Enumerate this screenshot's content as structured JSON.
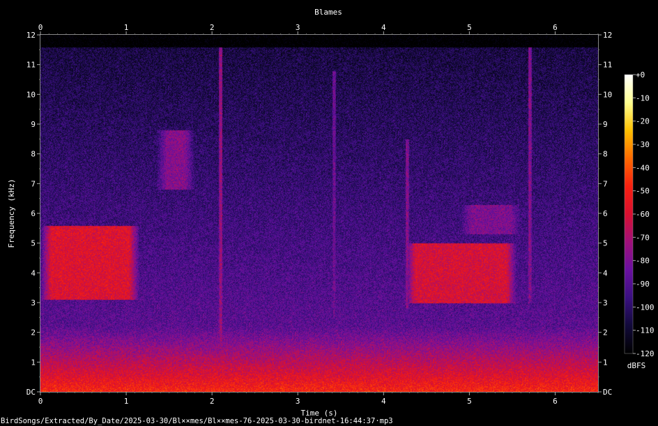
{
  "chart_data": {
    "type": "heatmap",
    "title": "Blames",
    "xlabel": "Time (s)",
    "ylabel": "Frequency (kHz)",
    "xlim": [
      0,
      6.5
    ],
    "ylim": [
      0,
      12
    ],
    "x_ticks": [
      "0",
      "1",
      "2",
      "3",
      "4",
      "5",
      "6"
    ],
    "y_ticks": [
      "DC",
      "1",
      "2",
      "3",
      "4",
      "5",
      "6",
      "7",
      "8",
      "9",
      "10",
      "11",
      "12"
    ],
    "colorbar": {
      "label": "dBFS",
      "range": [
        -120,
        0
      ],
      "ticks": [
        "+0",
        "-10",
        "-20",
        "-30",
        "-40",
        "-50",
        "-60",
        "-70",
        "-80",
        "-90",
        "-100",
        "-110",
        "-120"
      ],
      "colors": [
        "#000000",
        "#120a3a",
        "#3a1080",
        "#6a10a0",
        "#a0107a",
        "#d81030",
        "#f82010",
        "#ff6a00",
        "#ffc000",
        "#ffff90",
        "#ffffff"
      ]
    },
    "grid": false,
    "features": [
      {
        "kind": "band",
        "t": [
          0.0,
          1.15
        ],
        "f": [
          3.1,
          5.6
        ],
        "level": -58
      },
      {
        "kind": "band",
        "t": [
          4.25,
          5.55
        ],
        "f": [
          3.0,
          5.0
        ],
        "level": -60
      },
      {
        "kind": "band",
        "t": [
          1.35,
          1.8
        ],
        "f": [
          6.8,
          8.8
        ],
        "level": -78
      },
      {
        "kind": "band",
        "t": [
          4.9,
          5.6
        ],
        "f": [
          5.3,
          6.3
        ],
        "level": -80
      },
      {
        "kind": "click",
        "t": 2.1,
        "f": [
          0.0,
          11.6
        ],
        "level": -72
      },
      {
        "kind": "click",
        "t": 3.42,
        "f": [
          2.5,
          10.8
        ],
        "level": -82
      },
      {
        "kind": "click",
        "t": 4.27,
        "f": [
          2.8,
          8.5
        ],
        "level": -76
      },
      {
        "kind": "click",
        "t": 5.7,
        "f": [
          3.0,
          11.6
        ],
        "level": -76
      }
    ],
    "floor_level": -100,
    "low_freq_peak_level": -48
  },
  "footer": {
    "path": "BirdSongs/Extracted/By_Date/2025-03-30/Bl××mes/Bl××mes-76-2025-03-30-birdnet-16:44:37·mp3"
  }
}
